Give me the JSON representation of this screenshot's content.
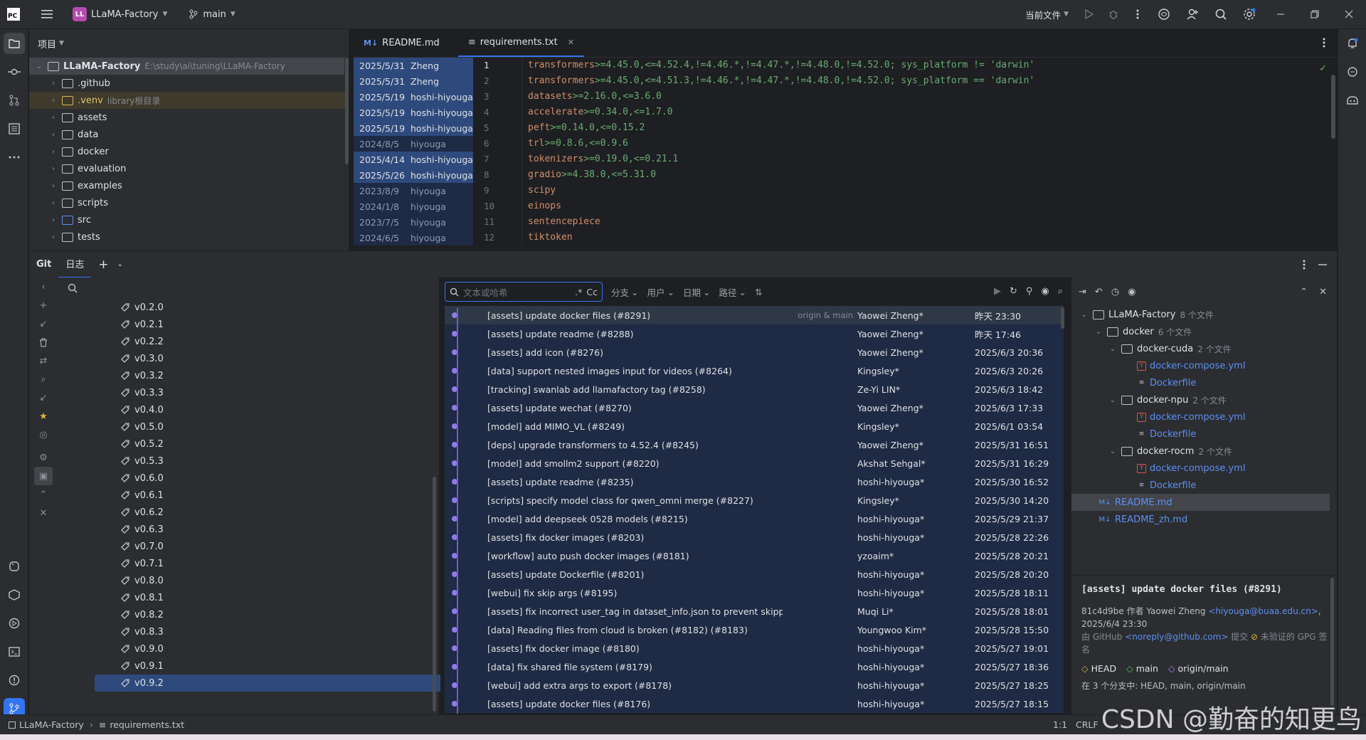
{
  "titlebar": {
    "project_logo": "LL",
    "project_name": "LLaMA-Factory",
    "branch": "main",
    "run_config": "当前文件",
    "icons": [
      "app-logo-icon",
      "hamburger-menu-icon",
      "branch-icon",
      "run-icon",
      "debug-icon",
      "more-icon",
      "ai-assistant-icon",
      "add-user-icon",
      "search-icon",
      "settings-icon",
      "minimize-icon",
      "restore-icon",
      "close-icon"
    ]
  },
  "project_panel": {
    "header": "项目",
    "root_name": "LLaMA-Factory",
    "root_path": "E:\\study\\ai\\tuning\\LLaMA-Factory",
    "items": [
      {
        "name": ".github"
      },
      {
        "name": ".venv",
        "note": "library根目录"
      },
      {
        "name": "assets"
      },
      {
        "name": "data"
      },
      {
        "name": "docker"
      },
      {
        "name": "evaluation"
      },
      {
        "name": "examples"
      },
      {
        "name": "scripts"
      },
      {
        "name": "src"
      },
      {
        "name": "tests"
      }
    ]
  },
  "editor": {
    "tabs": [
      {
        "icon": "M↓",
        "label": "README.md"
      },
      {
        "icon": "≡",
        "label": "requirements.txt"
      }
    ],
    "blame": [
      {
        "date": "2025/5/31",
        "author": "Zheng"
      },
      {
        "date": "2025/5/31",
        "author": "Zheng"
      },
      {
        "date": "2025/5/19",
        "author": "hoshi-hiyouga"
      },
      {
        "date": "2025/5/19",
        "author": "hoshi-hiyouga"
      },
      {
        "date": "2025/5/19",
        "author": "hoshi-hiyouga"
      },
      {
        "date": "2024/8/5",
        "author": "hiyouga"
      },
      {
        "date": "2025/4/14",
        "author": "hoshi-hiyouga"
      },
      {
        "date": "2025/5/26",
        "author": "hoshi-hiyouga"
      },
      {
        "date": "2023/8/9",
        "author": "hiyouga"
      },
      {
        "date": "2024/1/8",
        "author": "hiyouga"
      },
      {
        "date": "2023/7/5",
        "author": "hiyouga"
      },
      {
        "date": "2024/6/5",
        "author": "hiyouga"
      }
    ],
    "line_numbers": [
      "1",
      "2",
      "3",
      "4",
      "5",
      "6",
      "7",
      "8",
      "9",
      "10",
      "11",
      "12"
    ],
    "lines": [
      {
        "pkg": "transformers",
        "spec": ">=4.45.0,<=4.52.4,!=4.46.*,!=4.47.*,!=4.48.0,!=4.52.0; sys_platform != 'darwin'"
      },
      {
        "pkg": "transformers",
        "spec": ">=4.45.0,<=4.51.3,!=4.46.*,!=4.47.*,!=4.48.0,!=4.52.0; sys_platform == 'darwin'"
      },
      {
        "pkg": "datasets",
        "spec": ">=2.16.0,<=3.6.0"
      },
      {
        "pkg": "accelerate",
        "spec": ">=0.34.0,<=1.7.0"
      },
      {
        "pkg": "peft",
        "spec": ">=0.14.0,<=0.15.2"
      },
      {
        "pkg": "trl",
        "spec": ">=0.8.6,<=0.9.6"
      },
      {
        "pkg": "tokenizers",
        "spec": ">=0.19.0,<=0.21.1"
      },
      {
        "pkg": "gradio",
        "spec": ">=4.38.0,<=5.31.0"
      },
      {
        "pkg": "scipy",
        "spec": ""
      },
      {
        "pkg": "einops",
        "spec": ""
      },
      {
        "pkg": "sentencepiece",
        "spec": ""
      },
      {
        "pkg": "tiktoken",
        "spec": ""
      }
    ]
  },
  "git": {
    "title": "Git",
    "tab_log": "日志",
    "branch_tags": [
      "v0.2.0",
      "v0.2.1",
      "v0.2.2",
      "v0.3.0",
      "v0.3.2",
      "v0.3.3",
      "v0.4.0",
      "v0.5.0",
      "v0.5.2",
      "v0.5.3",
      "v0.6.0",
      "v0.6.1",
      "v0.6.2",
      "v0.6.3",
      "v0.7.0",
      "v0.7.1",
      "v0.8.0",
      "v0.8.1",
      "v0.8.2",
      "v0.8.3",
      "v0.9.0",
      "v0.9.1",
      "v0.9.2"
    ],
    "filter_placeholder": "文本或哈希",
    "regex_toggle": ".*",
    "case_toggle": "Cc",
    "filters": [
      "分支",
      "用户",
      "日期",
      "路径"
    ],
    "commits": [
      {
        "msg": "[assets] update docker files (#8291)",
        "refs": "origin & main",
        "author": "Yaowei Zheng*",
        "date": "昨天 23:30"
      },
      {
        "msg": "[assets] update readme (#8288)",
        "refs": "",
        "author": "Yaowei Zheng*",
        "date": "昨天 17:46"
      },
      {
        "msg": "[assets] add icon (#8276)",
        "refs": "",
        "author": "Yaowei Zheng*",
        "date": "2025/6/3 20:36"
      },
      {
        "msg": "[data] support nested images input for videos (#8264)",
        "refs": "",
        "author": "Kingsley*",
        "date": "2025/6/3 20:26"
      },
      {
        "msg": "[tracking] swanlab add llamafactory tag (#8258)",
        "refs": "",
        "author": "Ze-Yi LIN*",
        "date": "2025/6/3 18:42"
      },
      {
        "msg": "[assets] update wechat (#8270)",
        "refs": "",
        "author": "Yaowei Zheng*",
        "date": "2025/6/3 17:33"
      },
      {
        "msg": "[model] add MIMO_VL (#8249)",
        "refs": "",
        "author": "Kingsley*",
        "date": "2025/6/1 03:54"
      },
      {
        "msg": "[deps] upgrade transformers to 4.52.4 (#8245)",
        "refs": "",
        "author": "Yaowei Zheng*",
        "date": "2025/5/31 16:51"
      },
      {
        "msg": "[model] add smollm2 support (#8220)",
        "refs": "",
        "author": "Akshat Sehgal*",
        "date": "2025/5/31 16:29"
      },
      {
        "msg": "[assets] update readme (#8235)",
        "refs": "",
        "author": "hoshi-hiyouga*",
        "date": "2025/5/30 16:52"
      },
      {
        "msg": "[scripts] specify model class for qwen_omni merge (#8227)",
        "refs": "",
        "author": "Kingsley*",
        "date": "2025/5/30 14:20"
      },
      {
        "msg": "[model] add deepseek 0528 models (#8215)",
        "refs": "",
        "author": "hoshi-hiyouga*",
        "date": "2025/5/29 21:37"
      },
      {
        "msg": "[assets] fix docker images (#8203)",
        "refs": "",
        "author": "hoshi-hiyouga*",
        "date": "2025/5/28 22:26"
      },
      {
        "msg": "[workflow] auto push docker images (#8181)",
        "refs": "",
        "author": "yzoaim*",
        "date": "2025/5/28 20:21"
      },
      {
        "msg": "[assets] update Dockerfile (#8201)",
        "refs": "",
        "author": "hoshi-hiyouga*",
        "date": "2025/5/28 20:20"
      },
      {
        "msg": "[webui] fix skip args (#8195)",
        "refs": "",
        "author": "hoshi-hiyouga*",
        "date": "2025/5/28 18:11"
      },
      {
        "msg": "[assets] fix incorrect user_tag in dataset_info.json to prevent skipped entries (#8197)",
        "refs": "",
        "author": "Muqi Li*",
        "date": "2025/5/28 18:01"
      },
      {
        "msg": "[data] Reading files from cloud is broken (#8182) (#8183)",
        "refs": "",
        "author": "Youngwoo Kim*",
        "date": "2025/5/28 15:50"
      },
      {
        "msg": "[assets] fix docker image (#8180)",
        "refs": "",
        "author": "hoshi-hiyouga*",
        "date": "2025/5/27 19:01"
      },
      {
        "msg": "[data] fix shared file system (#8179)",
        "refs": "",
        "author": "hoshi-hiyouga*",
        "date": "2025/5/27 18:36"
      },
      {
        "msg": "[webui] add extra args to export (#8178)",
        "refs": "",
        "author": "hoshi-hiyouga*",
        "date": "2025/5/27 18:25"
      },
      {
        "msg": "[assets] update docker files (#8176)",
        "refs": "",
        "author": "hoshi-hiyouga*",
        "date": "2025/5/27 18:15"
      }
    ],
    "changes": {
      "root": "LLaMA-Factory",
      "root_count": "8 个文件",
      "docker": "docker",
      "docker_count": "6 个文件",
      "groups": [
        {
          "name": "docker-cuda",
          "count": "2 个文件"
        },
        {
          "name": "docker-npu",
          "count": "2 个文件"
        },
        {
          "name": "docker-rocm",
          "count": "2 个文件"
        }
      ],
      "compose": "docker-compose.yml",
      "dockerfile": "Dockerfile",
      "readme": "README.md",
      "readme_zh": "README_zh.md"
    },
    "detail": {
      "title": "[assets] update docker files (#8291)",
      "hash_line": "81c4d9be 作者 Yaowei Zheng",
      "email": "<hiyouga@buaa.edu.cn>",
      "date": ", 2025/6/4 23:30",
      "via": "由 GitHub",
      "via_email": "<noreply@github.com>",
      "via_suffix": "提交",
      "gpg": "未验证的 GPG 签名",
      "refs": [
        "HEAD",
        "main",
        "origin/main"
      ],
      "contained": "在 3 个分支中: HEAD, main, origin/main"
    }
  },
  "statusbar": {
    "project": "LLaMA-Factory",
    "file": "requirements.txt",
    "position": "1:1",
    "line_sep": "CRLF"
  },
  "watermark": "CSDN @勤奋的知更鸟"
}
